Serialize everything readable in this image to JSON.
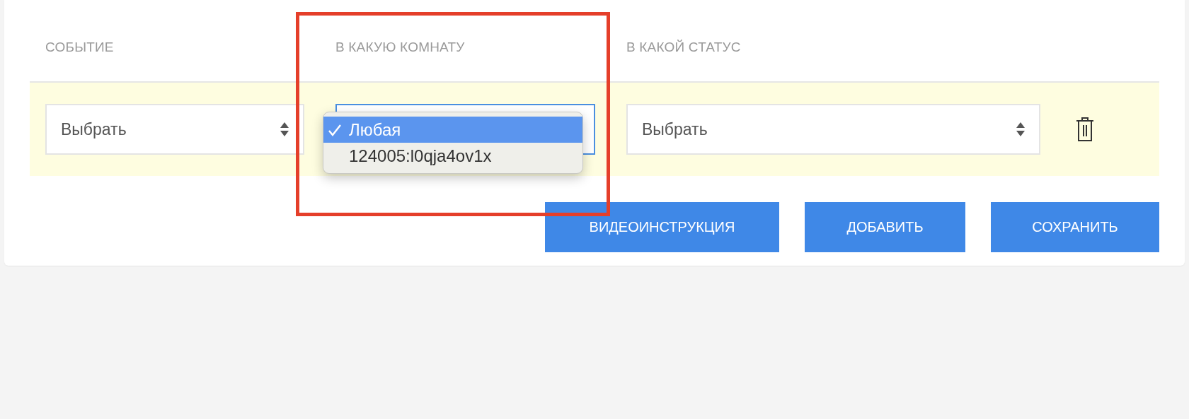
{
  "columns": [
    "СОБЫТИЕ",
    "В КАКУЮ КОМНАТУ",
    "В КАКОЙ СТАТУС"
  ],
  "row": {
    "event_select": {
      "value": "Выбрать"
    },
    "room_select": {
      "focused": true,
      "expanded": true,
      "options": [
        {
          "label": "Любая",
          "selected": true
        },
        {
          "label": "124005:l0qja4ov1x",
          "selected": false
        }
      ]
    },
    "status_select": {
      "value": "Выбрать"
    }
  },
  "buttons": [
    "ВИДЕОИНСТРУКЦИЯ",
    "ДОБАВИТЬ",
    "СОХРАНИТЬ"
  ]
}
